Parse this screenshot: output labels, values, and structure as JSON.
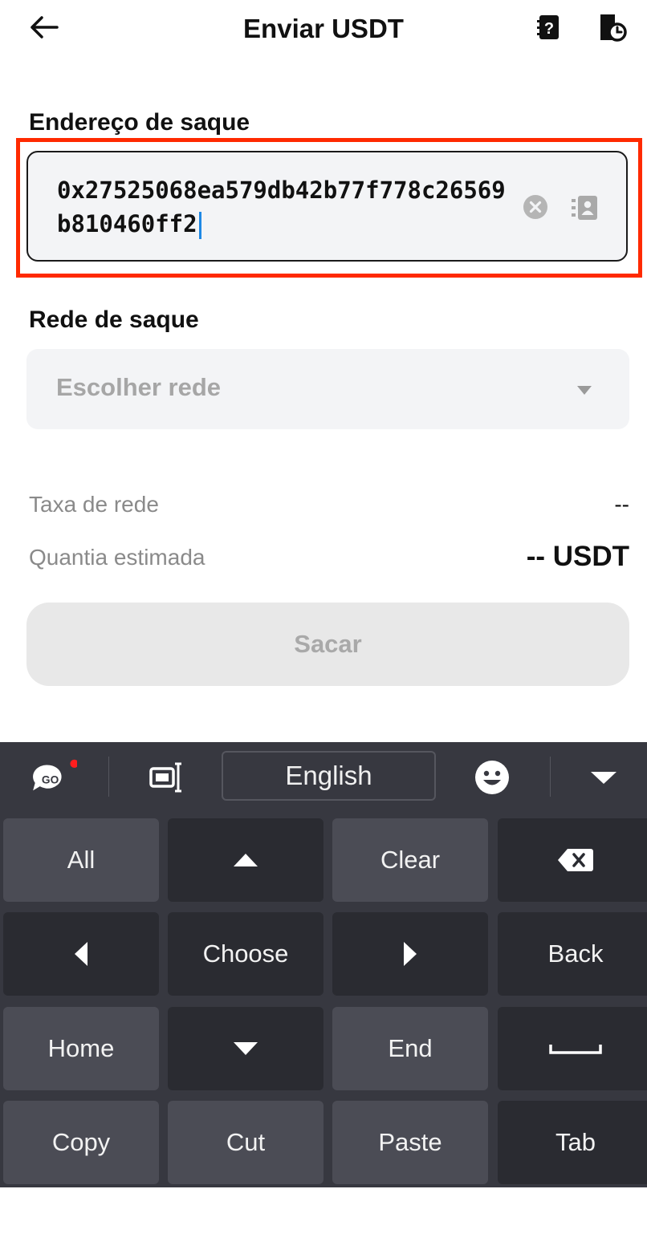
{
  "header": {
    "title": "Enviar USDT",
    "back_icon": "arrow-left-icon",
    "help_icon": "help-book-icon",
    "history_icon": "history-icon"
  },
  "address": {
    "label": "Endereço de saque",
    "value": "0x27525068ea579db42b77f778c26569b810460ff2",
    "clear_icon": "clear-icon",
    "contacts_icon": "address-book-icon",
    "highlight_color": "#ff2a00"
  },
  "network": {
    "label": "Rede de saque",
    "placeholder": "Escolher rede"
  },
  "fees": {
    "network_fee_label": "Taxa de rede",
    "network_fee_value": "--",
    "estimated_label": "Quantia estimada",
    "estimated_value": "-- USDT"
  },
  "submit": {
    "label": "Sacar"
  },
  "keyboard": {
    "language": "English",
    "toolbar_icons": [
      "go-logo-icon",
      "text-edit-icon",
      "emoji-icon",
      "collapse-keyboard-icon"
    ],
    "rows": [
      [
        "All",
        "",
        "Clear",
        ""
      ],
      [
        "",
        "Choose",
        "",
        "Back"
      ],
      [
        "Home",
        "",
        "End",
        ""
      ],
      [
        "Copy",
        "Cut",
        "Paste",
        "Tab"
      ]
    ],
    "icon_keys": [
      "up-arrow-icon",
      "backspace-icon",
      "left-arrow-icon",
      "right-arrow-icon",
      "down-arrow-icon",
      "space-icon"
    ]
  }
}
